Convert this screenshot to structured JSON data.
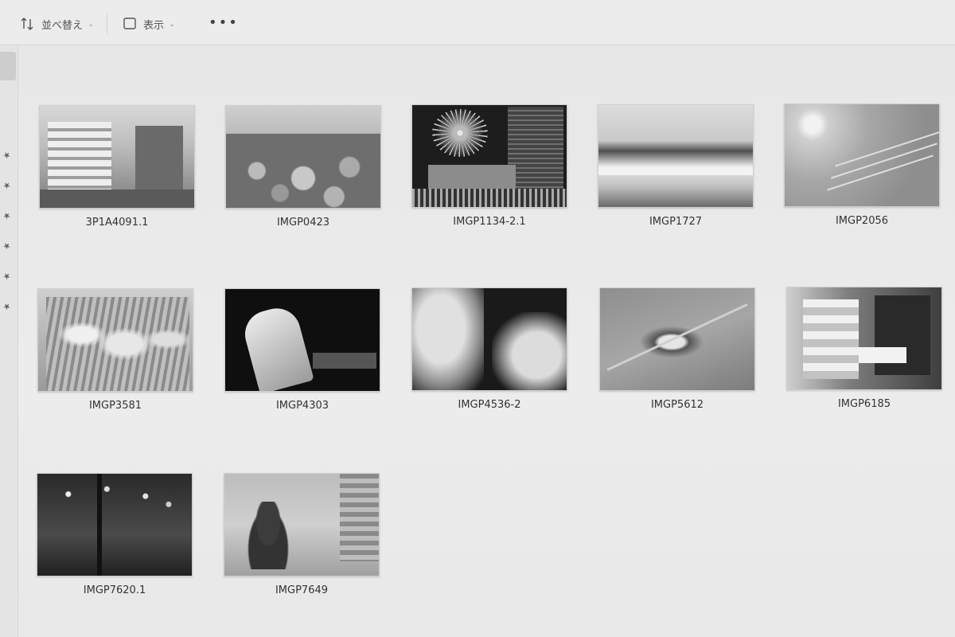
{
  "toolbar": {
    "sort_label": "並べ替え",
    "view_label": "表示",
    "more_label": "•••"
  },
  "files": [
    {
      "name": "3P1A4091.1"
    },
    {
      "name": "IMGP0423"
    },
    {
      "name": "IMGP1134-2.1"
    },
    {
      "name": "IMGP1727"
    },
    {
      "name": "IMGP2056"
    },
    {
      "name": "IMGP3581"
    },
    {
      "name": "IMGP4303"
    },
    {
      "name": "IMGP4536-2"
    },
    {
      "name": "IMGP5612"
    },
    {
      "name": "IMGP6185"
    },
    {
      "name": "IMGP7620.1"
    },
    {
      "name": "IMGP7649"
    }
  ]
}
